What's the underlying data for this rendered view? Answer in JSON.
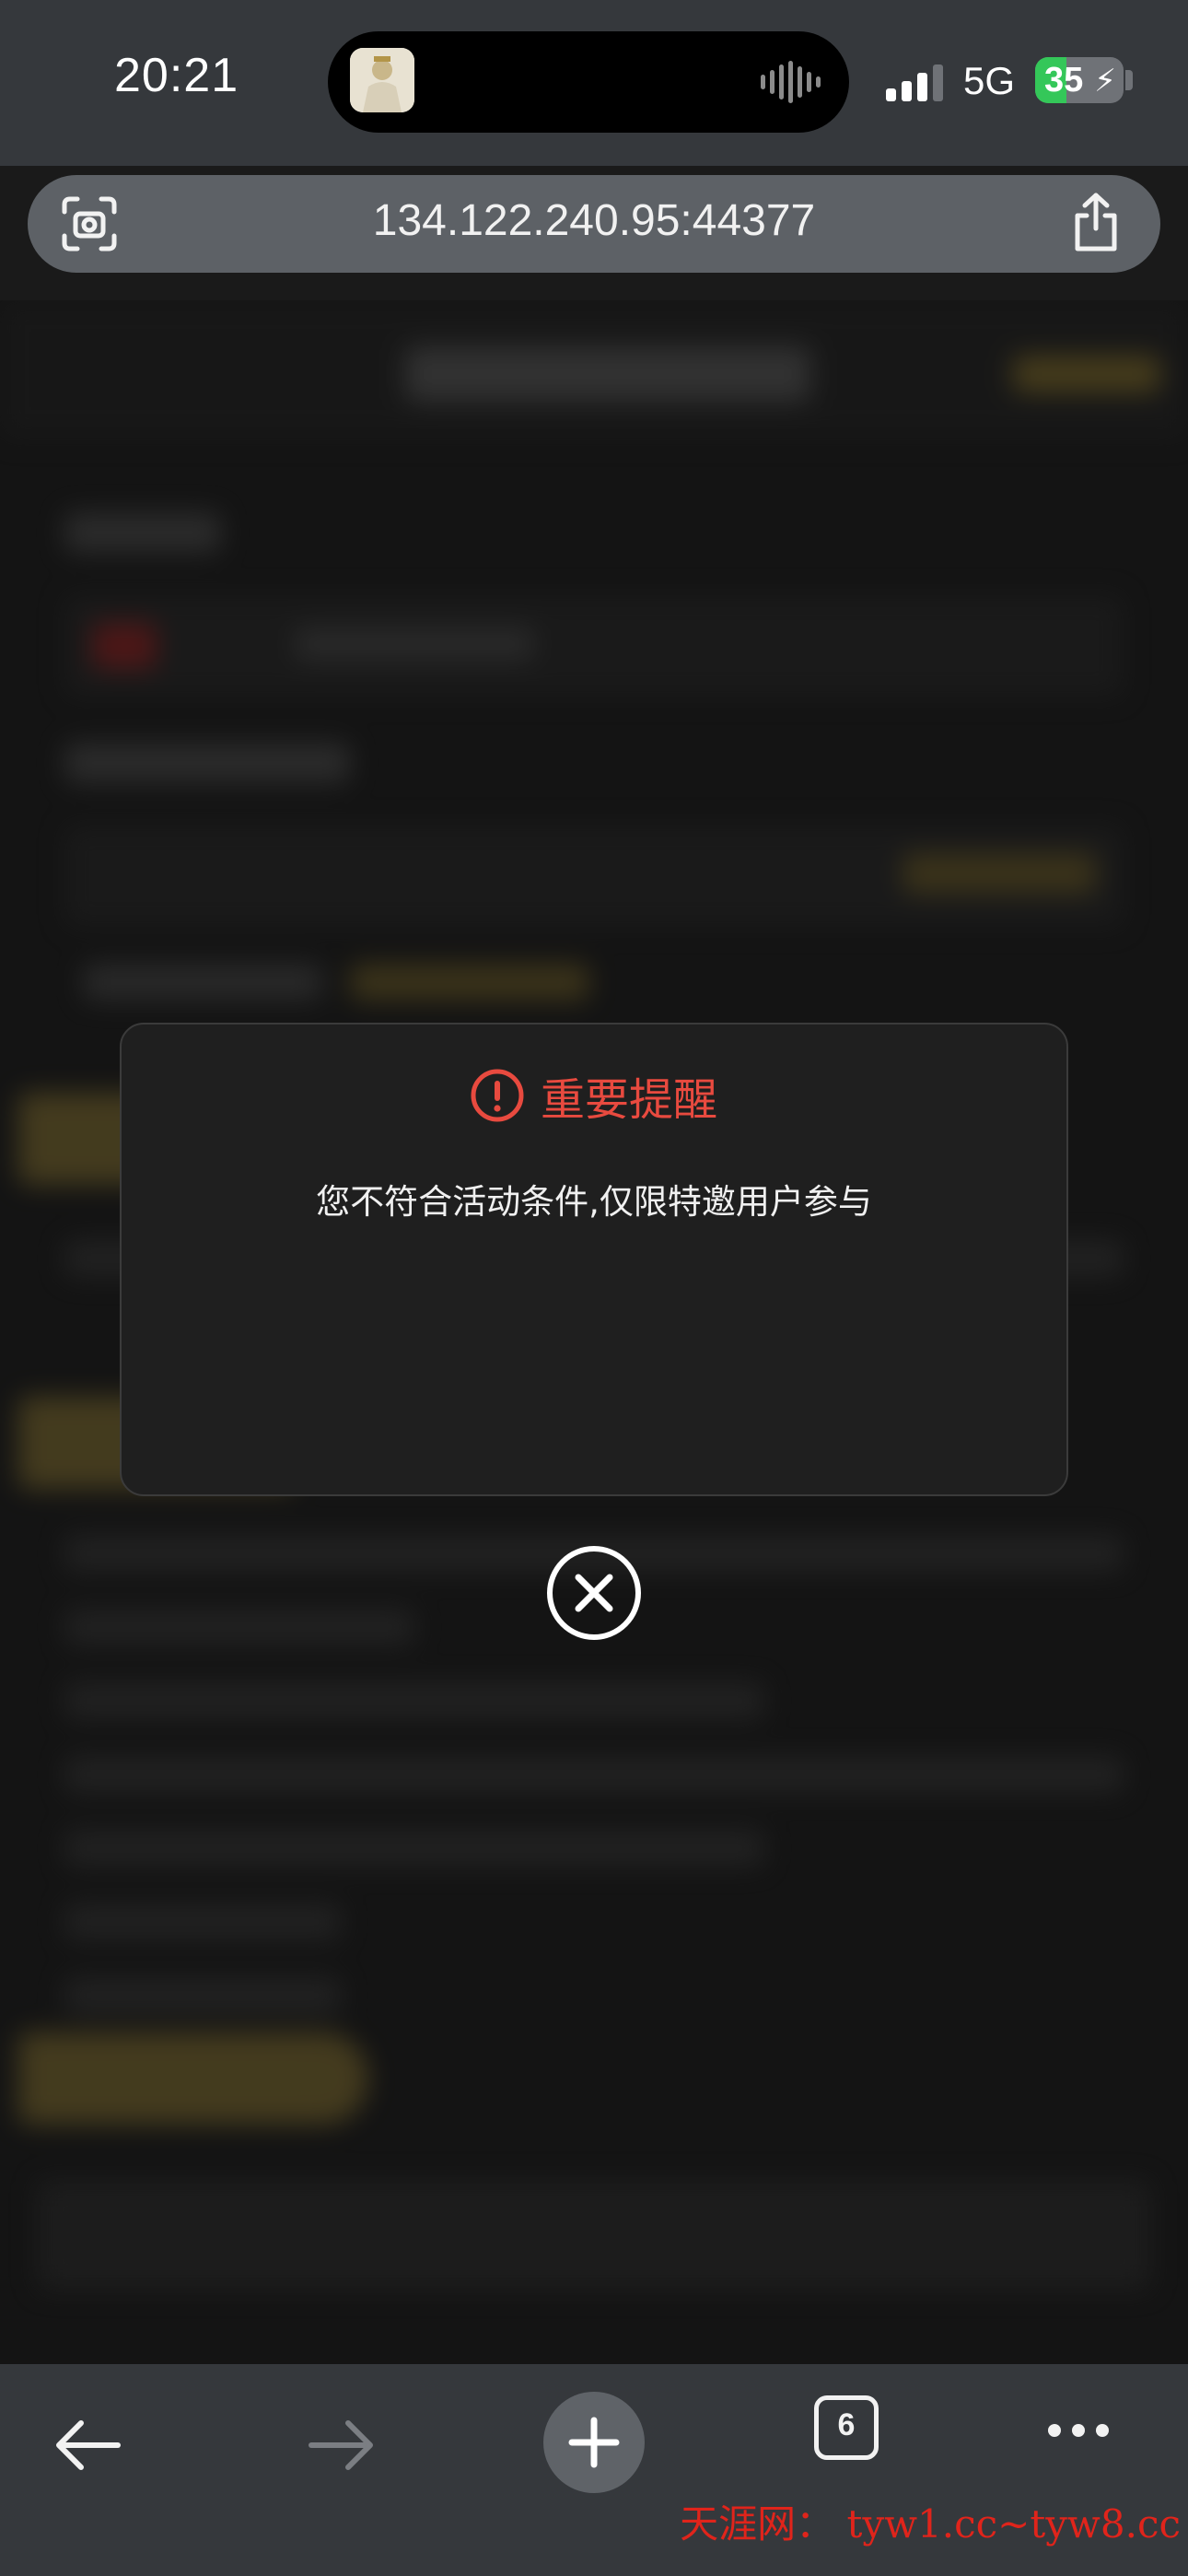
{
  "status_bar": {
    "time": "20:21",
    "network": "5G",
    "battery_level": "35",
    "battery_fraction": 0.35
  },
  "browser": {
    "url": "134.122.240.95:44377",
    "tab_count": "6"
  },
  "dialog": {
    "title": "重要提醒",
    "message": "您不符合活动条件,仅限特邀用户参与"
  },
  "watermark": "天涯网： tyw1.cc~tyw8.cc",
  "colors": {
    "alert_red": "#e84a3f",
    "gold_accent": "#8a7430",
    "battery_green": "#34c759"
  },
  "icons": {
    "scan": "camera-scan-icon",
    "share": "share-icon",
    "alert": "exclamation-circle-icon",
    "close": "close-circle-icon",
    "back": "arrow-left-icon",
    "forward": "arrow-right-icon",
    "new_tab": "plus-icon",
    "more": "ellipsis-icon"
  }
}
